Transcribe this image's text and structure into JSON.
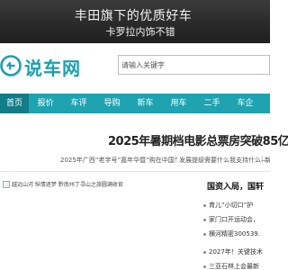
{
  "ad": {
    "line1": "丰田旗下的优质好车",
    "line2": "卡罗拉内饰不错"
  },
  "header": {
    "logo_text": "说车网",
    "search_placeholder": "请输入关键字"
  },
  "nav": {
    "items": [
      "首页",
      "报价",
      "车评",
      "导购",
      "新车",
      "用车",
      "二手",
      "车企"
    ],
    "active_index": 0
  },
  "headline": "2025年暑期档电影总票房突破85亿",
  "ticker": {
    "items": [
      "2025年广西“老字号”嘉年华暨“购在中国”",
      "发展提级需要什么我支持什么——南宁市加快产业",
      "新"
    ]
  },
  "featured": {
    "alt_text": "越远山河 纵情逐梦 黔南州丁寻山之旅圆满收官"
  },
  "news": {
    "heading": "国资入局，国轩",
    "items": [
      "育儿“小切口”护",
      "家门口开运动会，",
      "横河精密300539.",
      "2027年！关键技术",
      "三亚石林上会最新"
    ]
  },
  "colors": {
    "brand": "#1fa3b0",
    "nav_active": "#127d88",
    "ad_bg": "#2a2a2a"
  },
  "icons": {
    "logo": "logo-mark-icon",
    "broken_image": "broken-image-icon"
  }
}
